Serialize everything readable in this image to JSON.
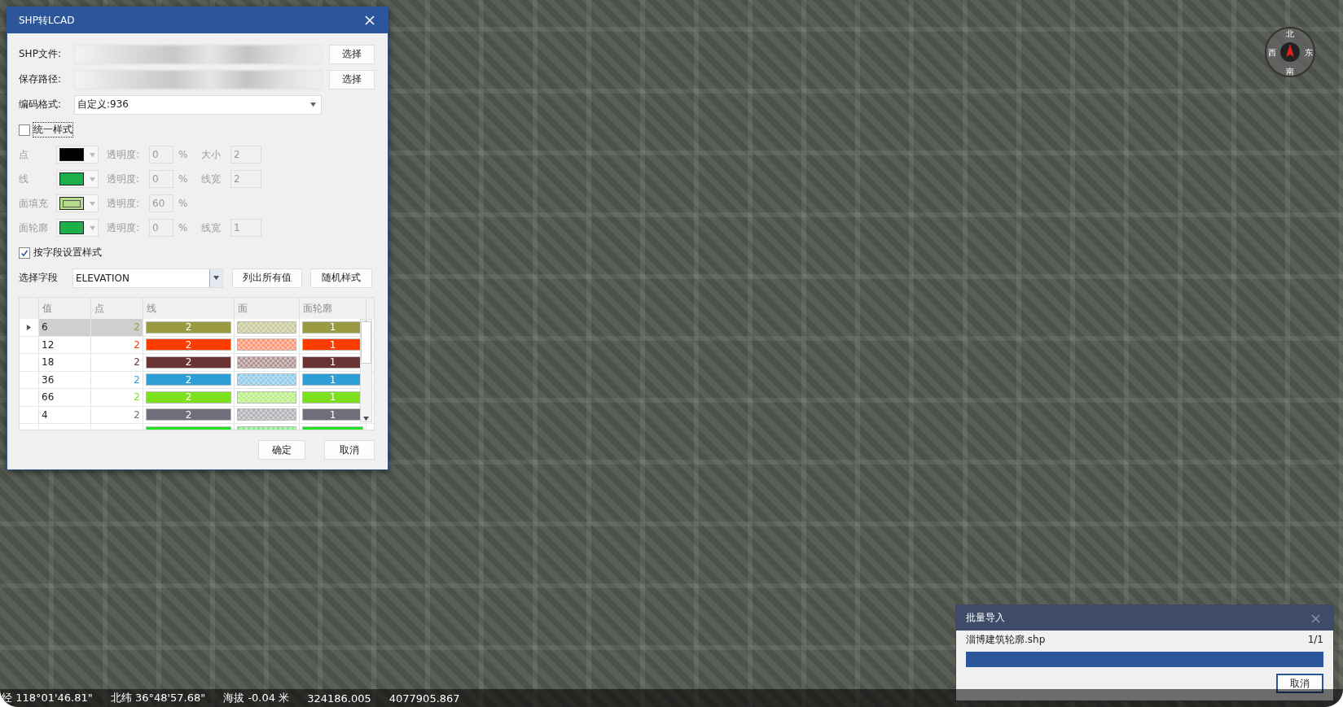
{
  "map": {
    "compass": {
      "north": "北",
      "east": "东",
      "south": "南",
      "west": "西"
    }
  },
  "dialog": {
    "title": "SHP转LCAD",
    "fields": [
      {
        "label": "SHP文件:",
        "kind": "blurred",
        "button": "选择"
      },
      {
        "label": "保存路径:",
        "kind": "blurred",
        "button": "选择"
      },
      {
        "label": "编码格式:",
        "kind": "dropdown",
        "value": "自定义:936"
      }
    ],
    "unified_style": {
      "label": "统一样式",
      "checked": false
    },
    "style_rows": [
      {
        "label": "点",
        "color": "#000000",
        "kind": "solid",
        "opacity_label": "透明度:",
        "opacity": "0",
        "unit": "%",
        "size_label": "大小",
        "size": "2"
      },
      {
        "label": "线",
        "color": "#1db04a",
        "kind": "solid",
        "opacity_label": "透明度:",
        "opacity": "0",
        "unit": "%",
        "size_label": "线宽",
        "size": "2"
      },
      {
        "label": "面填充",
        "color": "#b6dc8c",
        "kind": "framed",
        "opacity_label": "透明度:",
        "opacity": "60",
        "unit": "%"
      },
      {
        "label": "面轮廓",
        "color": "#1db04a",
        "kind": "solid",
        "opacity_label": "透明度:",
        "opacity": "0",
        "unit": "%",
        "size_label": "线宽",
        "size": "1"
      }
    ],
    "by_field": {
      "label": "按字段设置样式",
      "checked": true
    },
    "field_select": {
      "label": "选择字段",
      "value": "ELEVATION"
    },
    "actions": [
      "列出所有值",
      "随机样式"
    ],
    "table": {
      "columns": [
        "值",
        "点",
        "线",
        "面",
        "面轮廓"
      ],
      "rows": [
        {
          "value": "6",
          "point": "2",
          "line": "2",
          "outline": "1",
          "color": "#9a9a42",
          "selected": true
        },
        {
          "value": "12",
          "point": "2",
          "line": "2",
          "outline": "1",
          "color": "#ff3c00",
          "selected": false
        },
        {
          "value": "18",
          "point": "2",
          "line": "2",
          "outline": "1",
          "color": "#6b3434",
          "selected": false
        },
        {
          "value": "36",
          "point": "2",
          "line": "2",
          "outline": "1",
          "color": "#2e9fd6",
          "selected": false
        },
        {
          "value": "66",
          "point": "2",
          "line": "2",
          "outline": "1",
          "color": "#7de01c",
          "selected": false
        },
        {
          "value": "4",
          "point": "2",
          "line": "2",
          "outline": "1",
          "color": "#6f6f7c",
          "selected": false
        },
        {
          "color": "#22e022",
          "selected": false
        }
      ]
    },
    "buttons": [
      "确定",
      "取消"
    ]
  },
  "progress": {
    "title": "批量导入",
    "file": "淄博建筑轮廓.shp",
    "count": "1/1",
    "level": 1,
    "button": "取消"
  },
  "status_bar": [
    "经 118°01'46.81\"",
    "北纬 36°48'57.68\"",
    "海拔 -0.04 米",
    "324186.005",
    "4077905.867"
  ]
}
